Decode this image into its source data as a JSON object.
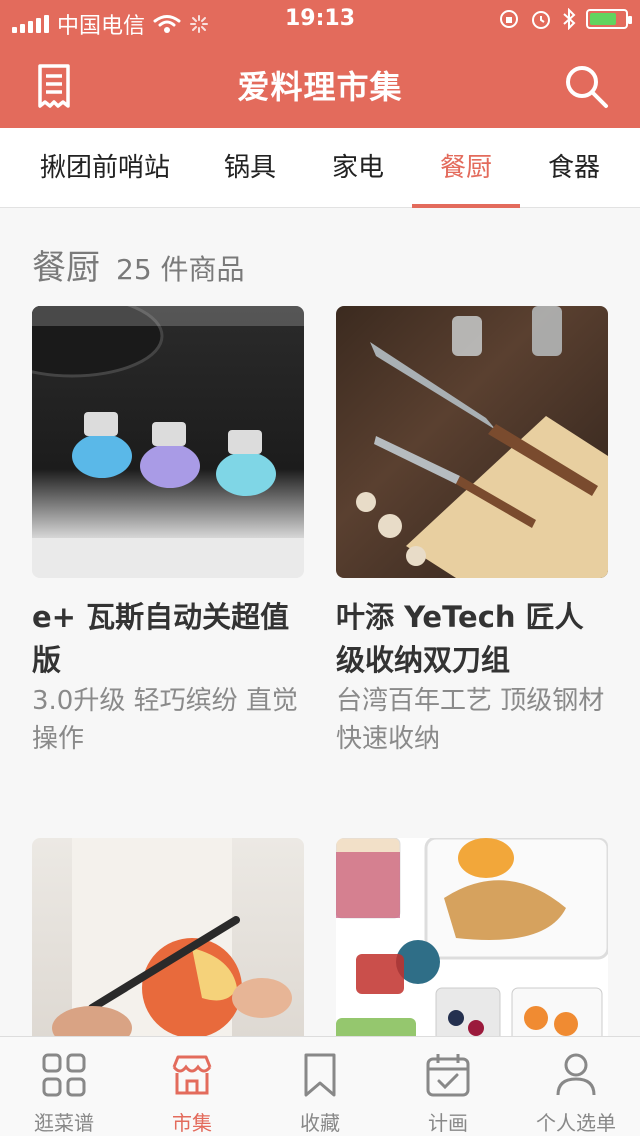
{
  "status_bar": {
    "carrier": "中国电信",
    "time": "19:13"
  },
  "header": {
    "title": "爱料理市集"
  },
  "tabs": [
    {
      "label": "揪团前哨站",
      "active": false
    },
    {
      "label": "锅具",
      "active": false
    },
    {
      "label": "家电",
      "active": false
    },
    {
      "label": "餐厨",
      "active": true
    },
    {
      "label": "食器",
      "active": false
    }
  ],
  "section": {
    "name": "餐厨",
    "count": "25 件商品"
  },
  "products": [
    {
      "title": "e+ 瓦斯自动关超值版",
      "desc": "3.0升级 轻巧缤纷 直觉操作"
    },
    {
      "title": "叶添 YeTech 匠人级收纳双刀组",
      "desc": "台湾百年工艺 顶级钢材 快速收纳"
    },
    {
      "title": "",
      "desc": ""
    },
    {
      "title": "",
      "desc": ""
    }
  ],
  "tabbar": [
    {
      "label": "逛菜谱",
      "icon": "grid-icon",
      "active": false
    },
    {
      "label": "市集",
      "icon": "store-icon",
      "active": true
    },
    {
      "label": "收藏",
      "icon": "bookmark-icon",
      "active": false
    },
    {
      "label": "计画",
      "icon": "calendar-check-icon",
      "active": false
    },
    {
      "label": "个人选单",
      "icon": "person-icon",
      "active": false
    }
  ],
  "colors": {
    "brand": "#e36b5c",
    "battery": "#62d45f"
  }
}
